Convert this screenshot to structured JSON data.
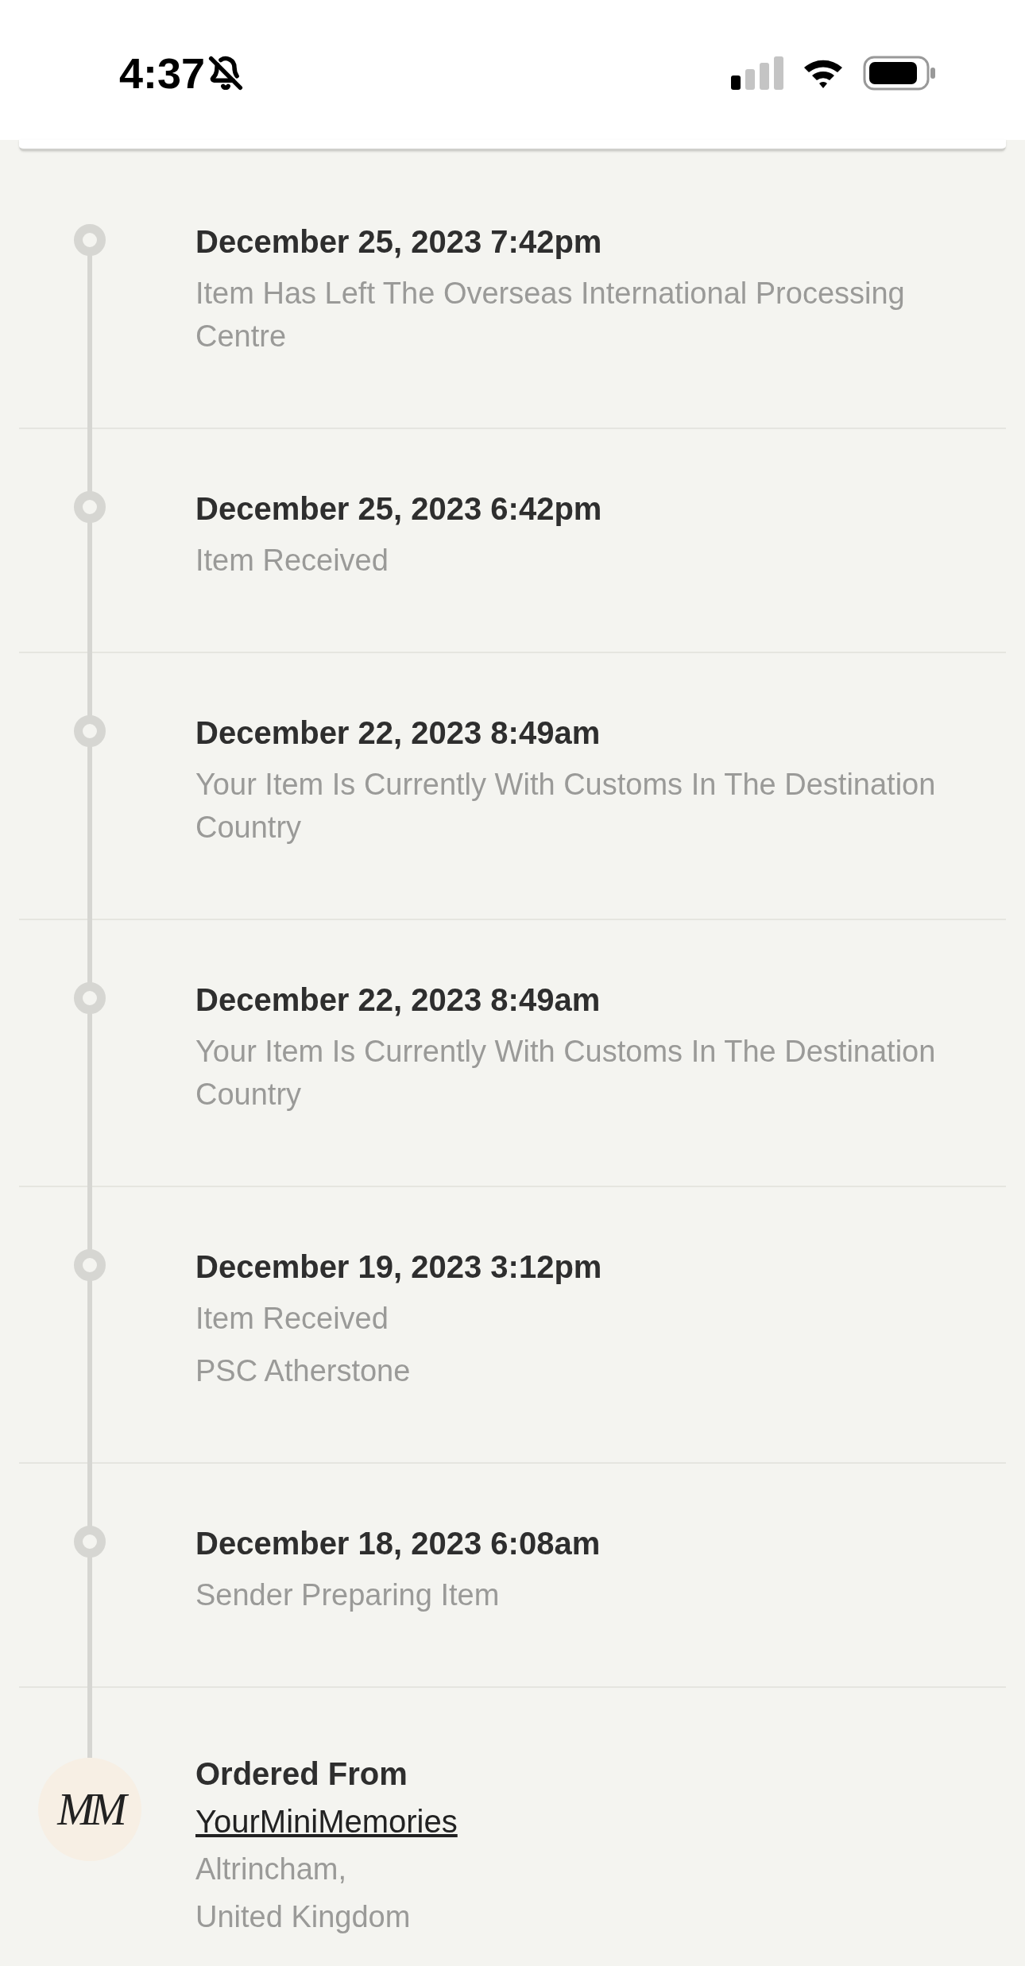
{
  "status_bar": {
    "time": "4:37"
  },
  "events": [
    {
      "date": "December 25, 2023 7:42pm",
      "details": [
        "Item Has Left The Overseas International Processing Centre"
      ]
    },
    {
      "date": "December 25, 2023 6:42pm",
      "details": [
        "Item Received"
      ]
    },
    {
      "date": "December 22, 2023 8:49am",
      "details": [
        "Your Item Is Currently With Customs In The Destination Country"
      ]
    },
    {
      "date": "December 22, 2023 8:49am",
      "details": [
        "Your Item Is Currently With Customs In The Destination Country"
      ]
    },
    {
      "date": "December 19, 2023 3:12pm",
      "details": [
        "Item Received",
        "PSC Atherstone"
      ]
    },
    {
      "date": "December 18, 2023 6:08am",
      "details": [
        "Sender Preparing Item"
      ]
    }
  ],
  "origin": {
    "logo": "MM",
    "title": "Ordered From",
    "shop": "YourMiniMemories",
    "location": [
      "Altrincham,",
      "United Kingdom"
    ]
  }
}
